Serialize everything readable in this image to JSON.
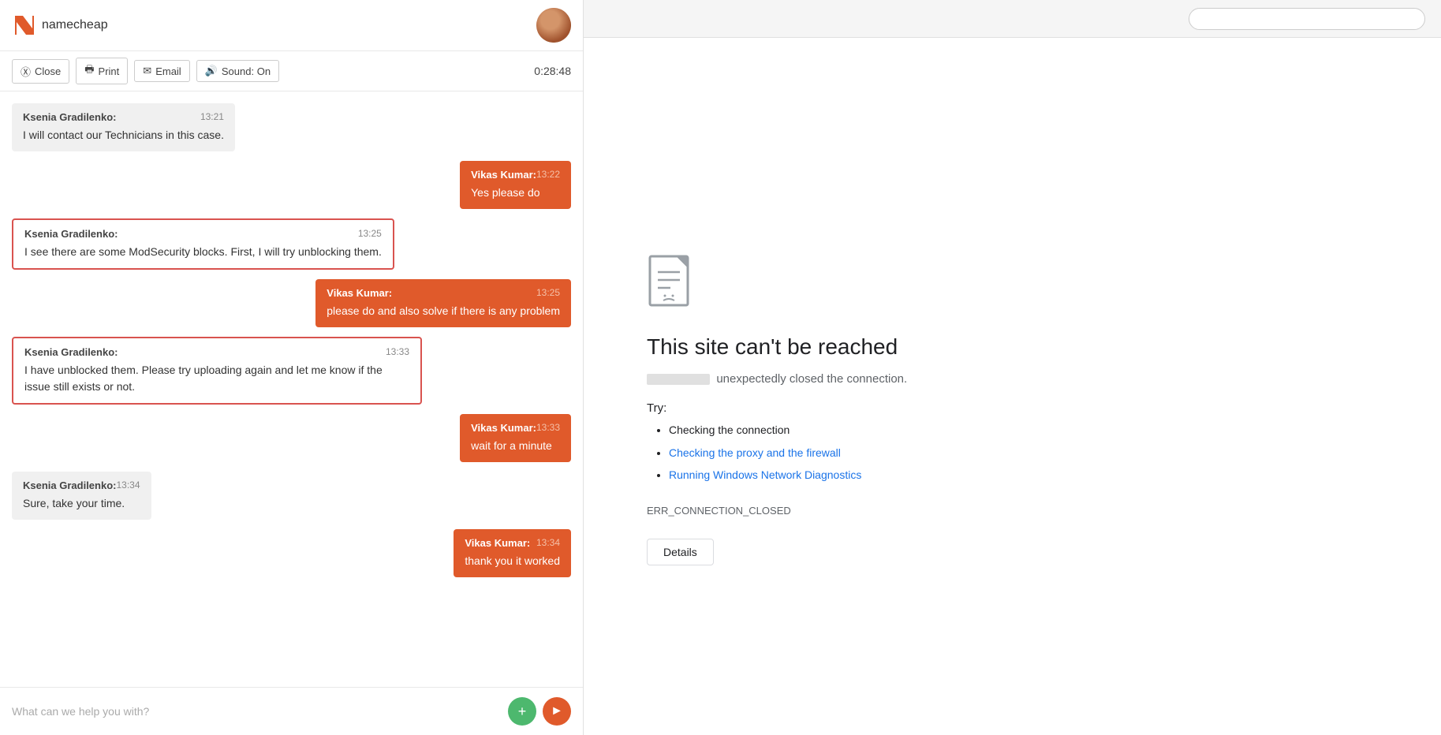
{
  "chat": {
    "logo_text": "namecheap",
    "timer": "0:28:48",
    "toolbar": {
      "close_label": "Close",
      "print_label": "Print",
      "email_label": "Email",
      "sound_label": "Sound: On"
    },
    "messages": [
      {
        "id": "msg1",
        "type": "agent",
        "sender": "Ksenia Gradilenko:",
        "time": "13:21",
        "text": "I will contact our Technicians in this case.",
        "highlighted": false
      },
      {
        "id": "msg2",
        "type": "user",
        "sender": "Vikas Kumar:",
        "time": "13:22",
        "text": "Yes please do",
        "highlighted": false
      },
      {
        "id": "msg3",
        "type": "agent",
        "sender": "Ksenia Gradilenko:",
        "time": "13:25",
        "text": "I see there are some ModSecurity blocks. First, I will try unblocking them.",
        "highlighted": true
      },
      {
        "id": "msg4",
        "type": "user",
        "sender": "Vikas Kumar:",
        "time": "13:25",
        "text": "please do and also solve if there is any problem",
        "highlighted": false
      },
      {
        "id": "msg5",
        "type": "agent",
        "sender": "Ksenia Gradilenko:",
        "time": "13:33",
        "text": "I have unblocked them. Please try uploading again and let me know if the issue still exists or not.",
        "highlighted": true
      },
      {
        "id": "msg6",
        "type": "user",
        "sender": "Vikas Kumar:",
        "time": "13:33",
        "text": "wait for a minute",
        "highlighted": false
      },
      {
        "id": "msg7",
        "type": "agent",
        "sender": "Ksenia Gradilenko:",
        "time": "13:34",
        "text": "Sure, take your time.",
        "highlighted": false
      },
      {
        "id": "msg8",
        "type": "user",
        "sender": "Vikas Kumar:",
        "time": "13:34",
        "text": "thank you it worked",
        "highlighted": false
      }
    ],
    "input_placeholder": "What can we help you with?"
  },
  "browser": {
    "error_title": "This site can't be reached",
    "error_subtitle_prefix": "",
    "error_subtitle_suffix": "unexpectedly closed the connection.",
    "try_label": "Try:",
    "suggestions": [
      {
        "text": "Checking the connection",
        "link": false
      },
      {
        "text": "Checking the proxy and the firewall",
        "link": true
      },
      {
        "text": "Running Windows Network Diagnostics",
        "link": true
      }
    ],
    "error_code": "ERR_CONNECTION_CLOSED",
    "details_label": "Details"
  }
}
